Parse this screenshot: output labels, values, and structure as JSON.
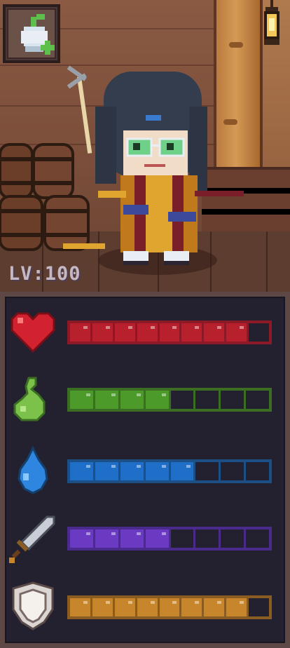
{
  "hud": {
    "level_label": "LV:100",
    "equipped_item_icon": "potion-plus-icon"
  },
  "stats": [
    {
      "key": "health",
      "icon": "heart-icon",
      "filled": 8,
      "total": 9,
      "fill_color": "#b8202d",
      "frame_color": "#8c1a26",
      "empty_color": "#23202f"
    },
    {
      "key": "stamina",
      "icon": "leaf-icon",
      "filled": 4,
      "total": 8,
      "fill_color": "#4c9a2a",
      "frame_color": "#3b6e22",
      "empty_color": "#23202f"
    },
    {
      "key": "mana",
      "icon": "droplet-icon",
      "filled": 5,
      "total": 8,
      "fill_color": "#1f6fc8",
      "frame_color": "#1c4f86",
      "empty_color": "#23202f"
    },
    {
      "key": "attack",
      "icon": "sword-icon",
      "filled": 4,
      "total": 8,
      "fill_color": "#6a3bc2",
      "frame_color": "#4a2a8a",
      "empty_color": "#23202f"
    },
    {
      "key": "defense",
      "icon": "shield-icon",
      "filled": 8,
      "total": 9,
      "fill_color": "#c7862c",
      "frame_color": "#8a5c22",
      "empty_color": "#23202f"
    }
  ]
}
